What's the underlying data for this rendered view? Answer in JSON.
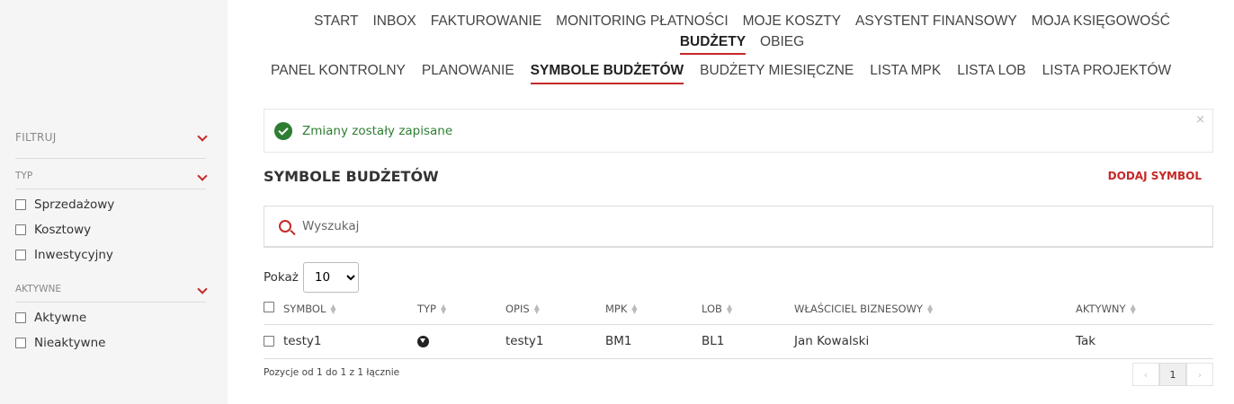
{
  "sidebar": {
    "filter_label": "FILTRUJ",
    "groups": [
      {
        "title": "TYP",
        "options": [
          "Sprzedażowy",
          "Kosztowy",
          "Inwestycyjny"
        ]
      },
      {
        "title": "AKTYWNE",
        "options": [
          "Aktywne",
          "Nieaktywne"
        ]
      }
    ]
  },
  "top_nav": {
    "items": [
      "START",
      "INBOX",
      "FAKTUROWANIE",
      "MONITORING PŁATNOŚCI",
      "MOJE KOSZTY",
      "ASYSTENT FINANSOWY",
      "MOJA KSIĘGOWOŚĆ",
      "BUDŻETY",
      "OBIEG"
    ],
    "active": "BUDŻETY"
  },
  "sub_nav": {
    "items": [
      "PANEL KONTROLNY",
      "PLANOWANIE",
      "SYMBOLE BUDŻETÓW",
      "BUDŻETY MIESIĘCZNE",
      "LISTA MPK",
      "LISTA LOB",
      "LISTA PROJEKTÓW"
    ],
    "active": "SYMBOLE BUDŻETÓW"
  },
  "alert": {
    "message": "Zmiany zostały zapisane",
    "close": "×"
  },
  "section": {
    "title": "SYMBOLE BUDŻETÓW",
    "add_button": "DODAJ SYMBOL"
  },
  "search": {
    "placeholder": "Wyszukaj"
  },
  "page_size": {
    "label": "Pokaż",
    "value": "10"
  },
  "table": {
    "columns": [
      "SYMBOL",
      "TYP",
      "OPIS",
      "MPK",
      "LOB",
      "WŁAŚCICIEL BIZNESOWY",
      "AKTYWNY"
    ],
    "rows": [
      {
        "symbol": "testy1",
        "typ_icon": "arrow-down-circle-icon",
        "opis": "testy1",
        "mpk": "BM1",
        "lob": "BL1",
        "wlasciciel": "Jan Kowalski",
        "aktywny": "Tak"
      }
    ]
  },
  "footer": {
    "info": "Pozycje od 1 do 1 z 1 łącznie",
    "pager": {
      "prev": "‹",
      "current": "1",
      "next": "›"
    }
  },
  "colors": {
    "accent": "#c62828",
    "success": "#2e7d32",
    "sidebar_bg": "#f5f5f5"
  }
}
